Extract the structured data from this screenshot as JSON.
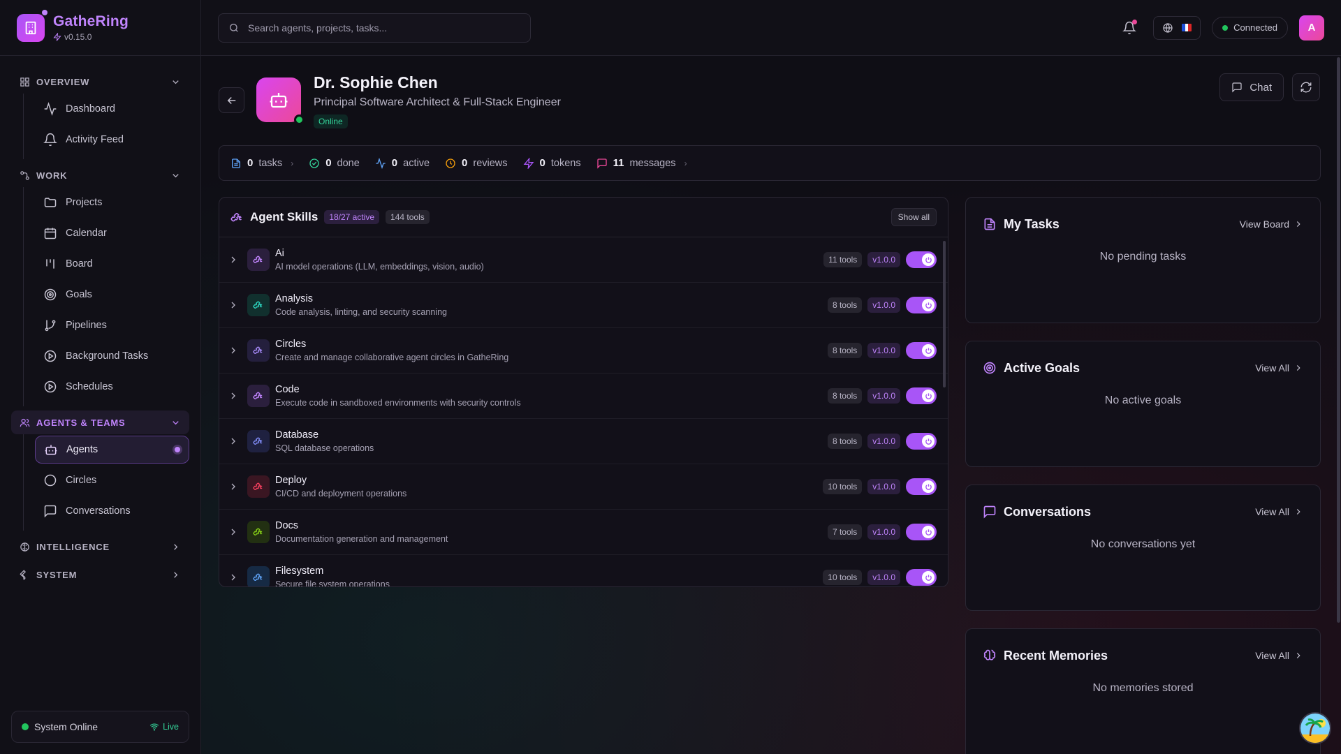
{
  "brand": {
    "name": "GatheRing",
    "version": "v0.15.0"
  },
  "search": {
    "placeholder": "Search agents, projects, tasks..."
  },
  "topbar": {
    "connection": "Connected",
    "avatar_letter": "A"
  },
  "sidebar": {
    "overview": {
      "label": "OVERVIEW",
      "items": [
        "Dashboard",
        "Activity Feed"
      ]
    },
    "work": {
      "label": "WORK",
      "items": [
        "Projects",
        "Calendar",
        "Board",
        "Goals",
        "Pipelines",
        "Background Tasks",
        "Schedules"
      ]
    },
    "agents_teams": {
      "label": "AGENTS & TEAMS",
      "items": [
        "Agents",
        "Circles",
        "Conversations"
      ]
    },
    "intelligence": {
      "label": "INTELLIGENCE"
    },
    "system": {
      "label": "SYSTEM"
    },
    "status": {
      "text": "System Online",
      "live": "Live"
    }
  },
  "agent": {
    "name": "Dr. Sophie Chen",
    "title": "Principal Software Architect & Full-Stack Engineer",
    "status": "Online",
    "chat_label": "Chat"
  },
  "stats": [
    {
      "value": "0",
      "label": "tasks",
      "icon": "file-icon",
      "color": "#60a5fa",
      "chevron": true
    },
    {
      "value": "0",
      "label": "done",
      "icon": "check-circle-icon",
      "color": "#34d399",
      "chevron": false
    },
    {
      "value": "0",
      "label": "active",
      "icon": "activity-icon",
      "color": "#60a5fa",
      "chevron": false
    },
    {
      "value": "0",
      "label": "reviews",
      "icon": "clock-icon",
      "color": "#f59e0b",
      "chevron": false
    },
    {
      "value": "0",
      "label": "tokens",
      "icon": "zap-icon",
      "color": "#a855f7",
      "chevron": false
    },
    {
      "value": "11",
      "label": "messages",
      "icon": "message-icon",
      "color": "#ec4899",
      "chevron": true
    }
  ],
  "skills": {
    "title": "Agent Skills",
    "active": "18/27 active",
    "tools": "144 tools",
    "show_all": "Show all",
    "items": [
      {
        "name": "Ai",
        "desc": "AI model operations (LLM, embeddings, vision, audio)",
        "tools": "11 tools",
        "version": "v1.0.0",
        "color": "#c084fc",
        "bg": "#2b1f3d",
        "enabled": true
      },
      {
        "name": "Analysis",
        "desc": "Code analysis, linting, and security scanning",
        "tools": "8 tools",
        "version": "v1.0.0",
        "color": "#2dd4bf",
        "bg": "#11302e",
        "enabled": true
      },
      {
        "name": "Circles",
        "desc": "Create and manage collaborative agent circles in GatheRing",
        "tools": "8 tools",
        "version": "v1.0.0",
        "color": "#a78bfa",
        "bg": "#241f3d",
        "enabled": true
      },
      {
        "name": "Code",
        "desc": "Execute code in sandboxed environments with security controls",
        "tools": "8 tools",
        "version": "v1.0.0",
        "color": "#c084fc",
        "bg": "#2b1f3d",
        "enabled": true
      },
      {
        "name": "Database",
        "desc": "SQL database operations",
        "tools": "8 tools",
        "version": "v1.0.0",
        "color": "#818cf8",
        "bg": "#1f2140",
        "enabled": true
      },
      {
        "name": "Deploy",
        "desc": "CI/CD and deployment operations",
        "tools": "10 tools",
        "version": "v1.0.0",
        "color": "#f43f5e",
        "bg": "#3a1622",
        "enabled": true
      },
      {
        "name": "Docs",
        "desc": "Documentation generation and management",
        "tools": "7 tools",
        "version": "v1.0.0",
        "color": "#84cc16",
        "bg": "#223012",
        "enabled": true
      },
      {
        "name": "Filesystem",
        "desc": "Secure file system operations",
        "tools": "10 tools",
        "version": "v1.0.0",
        "color": "#60a5fa",
        "bg": "#162a44",
        "enabled": true
      }
    ]
  },
  "cards": {
    "tasks": {
      "title": "My Tasks",
      "link": "View Board",
      "empty": "No pending tasks"
    },
    "goals": {
      "title": "Active Goals",
      "link": "View All",
      "empty": "No active goals"
    },
    "conversations": {
      "title": "Conversations",
      "link": "View All",
      "empty": "No conversations yet"
    },
    "memories": {
      "title": "Recent Memories",
      "link": "View All",
      "empty": "No memories stored"
    }
  },
  "colors": {
    "accent": "#a855f7",
    "accent_light": "#c084fc",
    "success": "#22c55e",
    "pink": "#ec4899"
  }
}
